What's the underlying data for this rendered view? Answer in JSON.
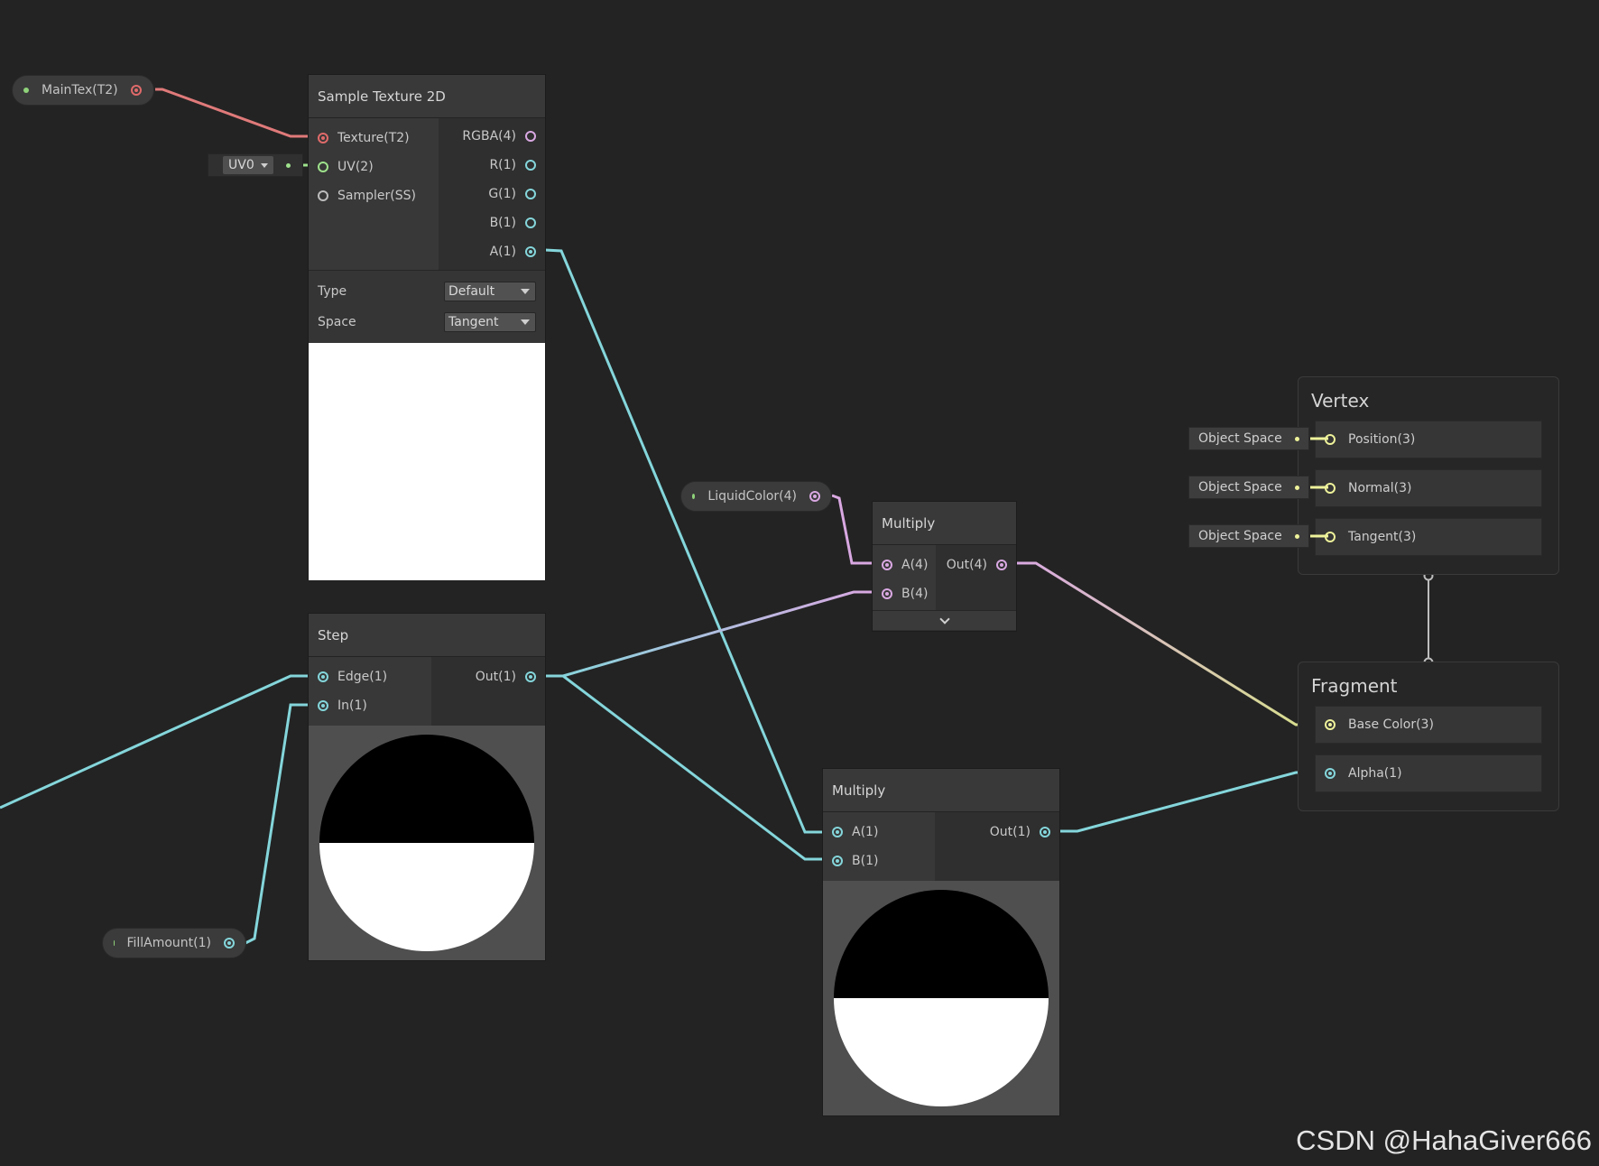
{
  "properties": {
    "main_tex": "MainTex(T2)",
    "liquid_color": "LiquidColor(4)",
    "fill_amount": "FillAmount(1)"
  },
  "sample_texture": {
    "title": "Sample Texture 2D",
    "inputs": [
      "Texture(T2)",
      "UV(2)",
      "Sampler(SS)"
    ],
    "outputs": [
      "RGBA(4)",
      "R(1)",
      "G(1)",
      "B(1)",
      "A(1)"
    ],
    "type_label": "Type",
    "type_value": "Default",
    "space_label": "Space",
    "space_value": "Tangent",
    "uv_channel": "UV0"
  },
  "step": {
    "title": "Step",
    "inputs": [
      "Edge(1)",
      "In(1)"
    ],
    "output": "Out(1)"
  },
  "multiply_color": {
    "title": "Multiply",
    "inputs": [
      "A(4)",
      "B(4)"
    ],
    "output": "Out(4)"
  },
  "multiply_alpha": {
    "title": "Multiply",
    "inputs": [
      "A(1)",
      "B(1)"
    ],
    "output": "Out(1)"
  },
  "vertex": {
    "title": "Vertex",
    "blocks": [
      "Position(3)",
      "Normal(3)",
      "Tangent(3)"
    ],
    "space": "Object Space"
  },
  "fragment": {
    "title": "Fragment",
    "blocks": [
      "Base Color(3)",
      "Alpha(1)"
    ]
  },
  "colors": {
    "texture": "#e06a6a",
    "vector4": "#d9a8e2",
    "float": "#84d6db",
    "vector2": "#9ee28c",
    "vector3": "#eef29a",
    "background": "#232323"
  },
  "watermark": "CSDN @HahaGiver666"
}
